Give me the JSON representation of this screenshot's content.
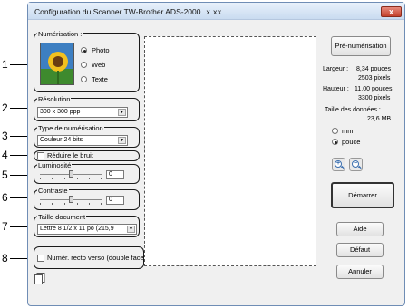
{
  "window": {
    "title": "Configuration du Scanner TW-Brother ADS-2000",
    "version": "x.xx",
    "close_label": "x"
  },
  "callouts": [
    "1",
    "2",
    "3",
    "4",
    "5",
    "6",
    "7",
    "8"
  ],
  "scan_type": {
    "label": "Numérisation :",
    "options": [
      "Photo",
      "Web",
      "Texte"
    ],
    "selected": "Photo"
  },
  "resolution": {
    "label": "Résolution",
    "value": "300 x 300 ppp"
  },
  "scan_mode": {
    "label": "Type de numérisation",
    "value": "Couleur 24 bits"
  },
  "noise": {
    "label": "Réduire le bruit",
    "checked": false
  },
  "brightness": {
    "label": "Luminosité",
    "value": "0"
  },
  "contrast": {
    "label": "Contraste",
    "value": "0"
  },
  "doc_size": {
    "label": "Taille document",
    "value": "Lettre 8 1/2 x 11 po (215,9"
  },
  "duplex": {
    "label": "Numér. recto verso (double face)",
    "checked": false
  },
  "prescan_button": "Pré-numérisation",
  "dimensions": {
    "width_label": "Largeur :",
    "width_in": "8,34 pouces",
    "width_px": "2503 pixels",
    "height_label": "Hauteur :",
    "height_in": "11,00 pouces",
    "height_px": "3300 pixels",
    "size_label": "Taille des données :",
    "size_value": "23,6 MB"
  },
  "unit": {
    "options": [
      "mm",
      "pouce"
    ],
    "selected": "pouce"
  },
  "buttons": {
    "start": "Démarrer",
    "help": "Aide",
    "default": "Défaut",
    "cancel": "Annuler"
  },
  "colors": {
    "titlebar": "#c9dbf0",
    "close": "#c3412c",
    "frame": "#6f8db5"
  }
}
